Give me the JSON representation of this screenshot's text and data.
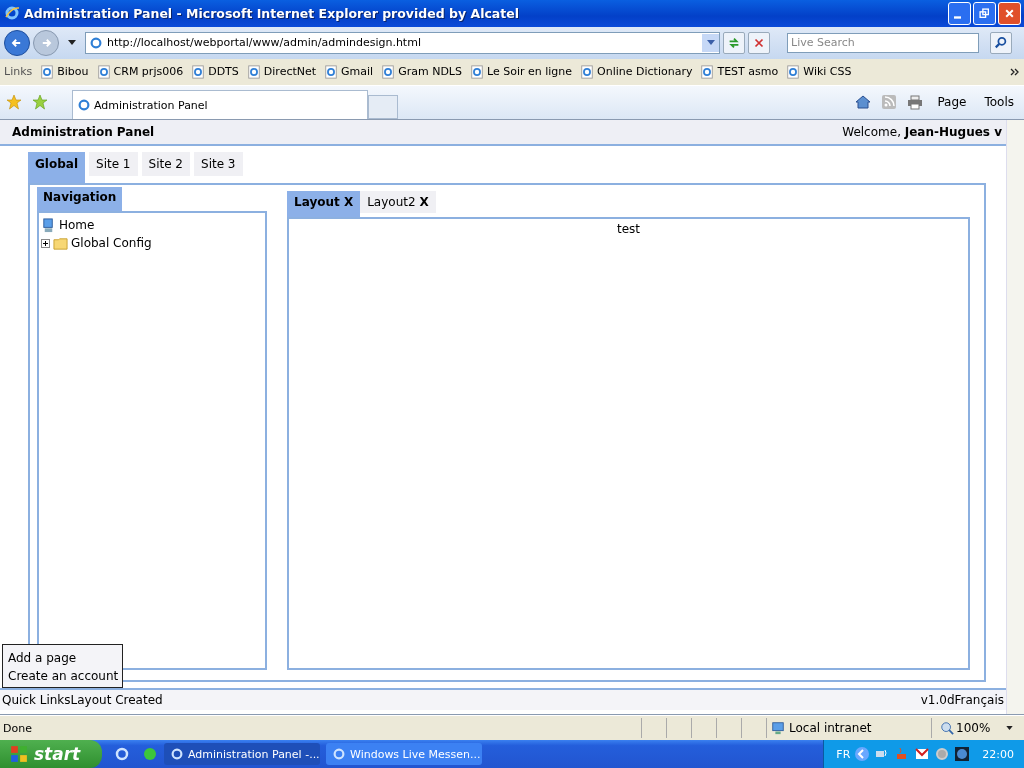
{
  "window": {
    "title": "Administration Panel - Microsoft Internet Explorer provided by Alcatel"
  },
  "address_bar": {
    "url": "http://localhost/webportal/www/admin/admindesign.html",
    "search_placeholder": "Live Search"
  },
  "links_bar": {
    "label": "Links",
    "links": [
      "Bibou",
      "CRM prjs006",
      "DDTS",
      "DirectNet",
      "Gmail",
      "Gram NDLS",
      "Le Soir en ligne",
      "Online Dictionary",
      "TEST asmo",
      "Wiki CSS"
    ]
  },
  "browser_tabs": [
    {
      "label": "Administration Panel",
      "selected": true
    }
  ],
  "command_bar": [
    "Page",
    "Tools"
  ],
  "page": {
    "header": {
      "title": "Administration Panel",
      "welcome": "Welcome, **Jean-Hugues v**"
    },
    "site_tabs": [
      {
        "label": "Global",
        "selected": true
      },
      {
        "label": "Site 1",
        "selected": false
      },
      {
        "label": "Site 2",
        "selected": false
      },
      {
        "label": "Site 3",
        "selected": false
      }
    ],
    "navigation": {
      "title": "Navigation",
      "tree": [
        {
          "label": "Home",
          "kind": "computer",
          "expanded": false
        },
        {
          "label": "Global Config",
          "kind": "folder",
          "expanded": false
        }
      ]
    },
    "layout_tabs": [
      {
        "label": "Layout",
        "close": "X",
        "selected": true
      },
      {
        "label": "Layout2",
        "close": "X",
        "selected": false
      }
    ],
    "content": "test",
    "popup_menu": [
      "Add a page",
      "Create an account"
    ],
    "footer": {
      "left": "Quick LinksLayout Created",
      "right": "v1.0dFrançais"
    }
  },
  "status_bar": {
    "text": "Done",
    "zone": "Local intranet",
    "zoom": "100%"
  },
  "taskbar": {
    "start": "start",
    "tasks": [
      {
        "label": "Administration Panel -...",
        "selected": true
      },
      {
        "label": "Windows Live Messen...",
        "selected": false
      }
    ],
    "language": "FR",
    "clock": "22:00"
  }
}
